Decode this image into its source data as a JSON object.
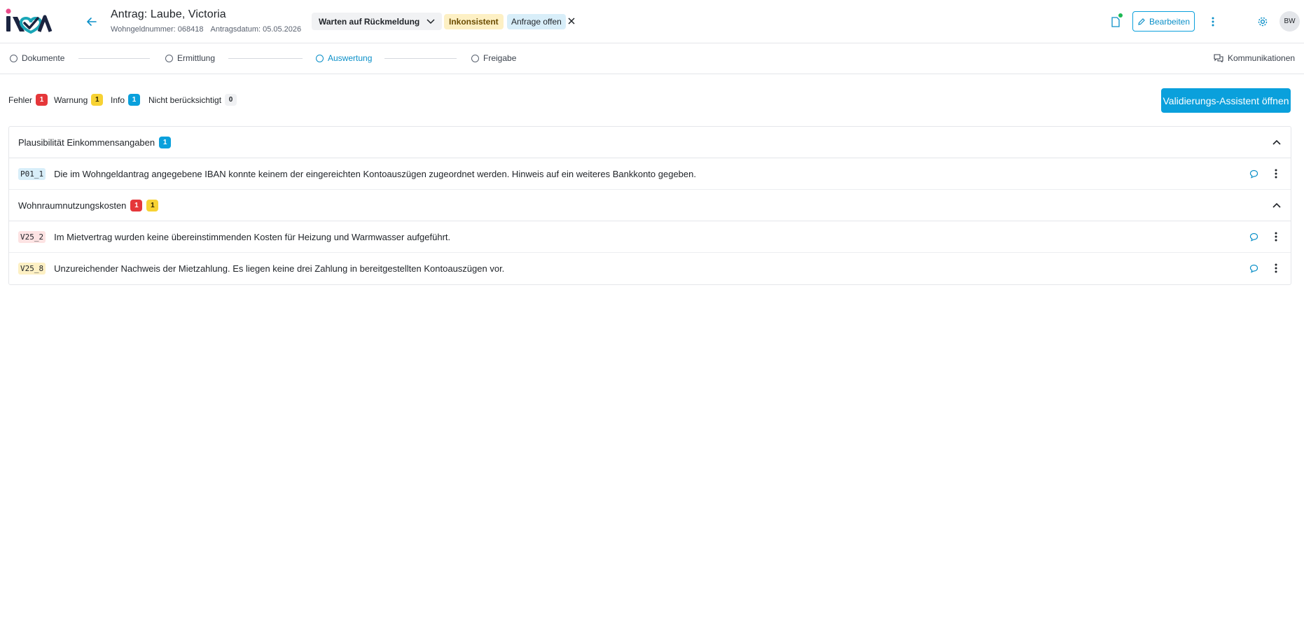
{
  "header": {
    "title": "Antrag: Laube, Victoria",
    "wohngeldnummer": "Wohngeldnummer: 068418",
    "antragsdatum": "Antragsdatum: 05.05.2026",
    "status_select": "Warten auf Rückmeldung",
    "badge_inconsistent": "Inkonsistent",
    "badge_anfrage": "Anfrage offen",
    "edit_label": "Bearbeiten",
    "avatar_initials": "BW"
  },
  "stepper": {
    "steps": [
      {
        "label": "Dokumente",
        "active": false
      },
      {
        "label": "Ermittlung",
        "active": false
      },
      {
        "label": "Auswertung",
        "active": true
      },
      {
        "label": "Freigabe",
        "active": false
      }
    ],
    "communications_label": "Kommunikationen"
  },
  "filters": [
    {
      "label": "Fehler",
      "count": "1",
      "color": "#e5373a"
    },
    {
      "label": "Warnung",
      "count": "1",
      "color": "#f7d233"
    },
    {
      "label": "Info",
      "count": "1",
      "color": "#0aa0dc"
    },
    {
      "label": "Nicht berücksichtigt",
      "count": "0",
      "color": "#f0f1f3"
    }
  ],
  "validate_button": "Validierungs-Assistent öffnen",
  "groups": [
    {
      "title": "Plausibilität Einkommensangaben",
      "badges": [
        "1"
      ],
      "items": [
        {
          "code": "P01_1",
          "text": "Die im Wohngeldantrag angegebene IBAN konnte keinem der eingereichten Kontoauszügen zugeordnet werden. Hinweis auf ein weiteres Bankkonto gegeben."
        }
      ]
    },
    {
      "title": "Wohnraumnutzungskosten",
      "badges": [
        "1",
        "1"
      ],
      "items": [
        {
          "code": "V25_2",
          "text": "Im Mietvertrag wurden keine übereinstimmenden Kosten für Heizung und Warmwasser aufgeführt."
        },
        {
          "code": "V25_8",
          "text": "Unzureichender Nachweis der Mietzahlung. Es liegen keine drei Zahlung in bereitgestellten Kontoauszügen vor."
        }
      ]
    }
  ],
  "colors": {
    "accent": "#0aa0dc",
    "error": "#e5373a",
    "warning": "#f7d233",
    "logo_dark": "#1b2440",
    "logo_teal": "#1aa6b7",
    "logo_pink": "#e94b8a"
  }
}
